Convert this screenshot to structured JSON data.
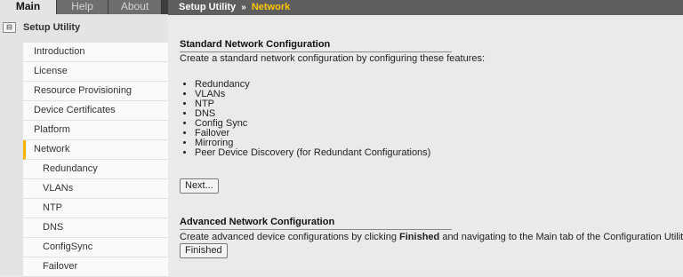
{
  "tabs": [
    {
      "label": "Main"
    },
    {
      "label": "Help"
    },
    {
      "label": "About"
    }
  ],
  "tree": {
    "title": "Setup Utility",
    "icon": "tree-collapse-icon"
  },
  "nav": {
    "items": [
      {
        "label": "Introduction"
      },
      {
        "label": "License"
      },
      {
        "label": "Resource Provisioning"
      },
      {
        "label": "Device Certificates"
      },
      {
        "label": "Platform"
      },
      {
        "label": "Network"
      },
      {
        "label": "Redundancy"
      },
      {
        "label": "VLANs"
      },
      {
        "label": "NTP"
      },
      {
        "label": "DNS"
      },
      {
        "label": "ConfigSync"
      },
      {
        "label": "Failover"
      }
    ]
  },
  "breadcrumb": {
    "root": "Setup Utility",
    "separator": "»",
    "current": "Network"
  },
  "standard": {
    "title": "Standard Network Configuration",
    "description": "Create a standard network configuration by configuring these features:",
    "features": [
      "Redundancy",
      "VLANs",
      "NTP",
      "DNS",
      "Config Sync",
      "Failover",
      "Mirroring",
      "Peer Device Discovery (for Redundant Configurations)"
    ],
    "next_label": "Next..."
  },
  "advanced": {
    "title": "Advanced Network Configuration",
    "desc_before": "Create advanced device configurations by clicking ",
    "desc_bold": "Finished",
    "desc_after": " and navigating to the Main tab of the Configuration Utility.",
    "finished_label": "Finished"
  },
  "colors": {
    "accent": "#ffc400",
    "active_marker": "#f7b500",
    "topbar": "#5e5e5e"
  }
}
